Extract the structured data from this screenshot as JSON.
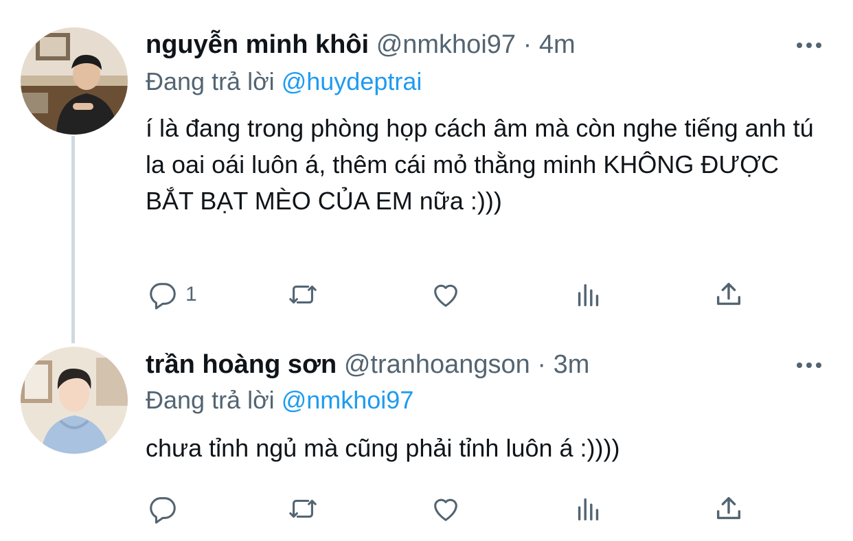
{
  "tweets": [
    {
      "name": "nguyễn minh khôi",
      "handle": "@nmkhoi97",
      "separator": "·",
      "time": "4m",
      "reply_prefix": "Đang trả lời",
      "reply_to": "@huydeptrai",
      "text": "í là đang trong phòng họp cách âm mà còn nghe tiếng anh tú la oai oái luôn á, thêm cái mỏ thằng minh KHÔNG ĐƯỢC BẮT BẠT MÈO CỦA EM nữa :)))",
      "reply_count": "1"
    },
    {
      "name": "trần hoàng sơn",
      "handle": "@tranhoangson",
      "separator": "·",
      "time": "3m",
      "reply_prefix": "Đang trả lời",
      "reply_to": "@nmkhoi97",
      "text": "chưa tỉnh ngủ mà cũng phải tỉnh luôn á :))))",
      "reply_count": ""
    }
  ],
  "icons": {
    "reply": "speech-bubble",
    "retweet": "retweet-arrows",
    "like": "heart",
    "views": "bar-chart",
    "share": "upload-arrow",
    "more": "three-dots"
  },
  "colors": {
    "text": "#0f1419",
    "secondary": "#536471",
    "mention": "#1d9bf0",
    "thread_line": "#cfd9de"
  }
}
